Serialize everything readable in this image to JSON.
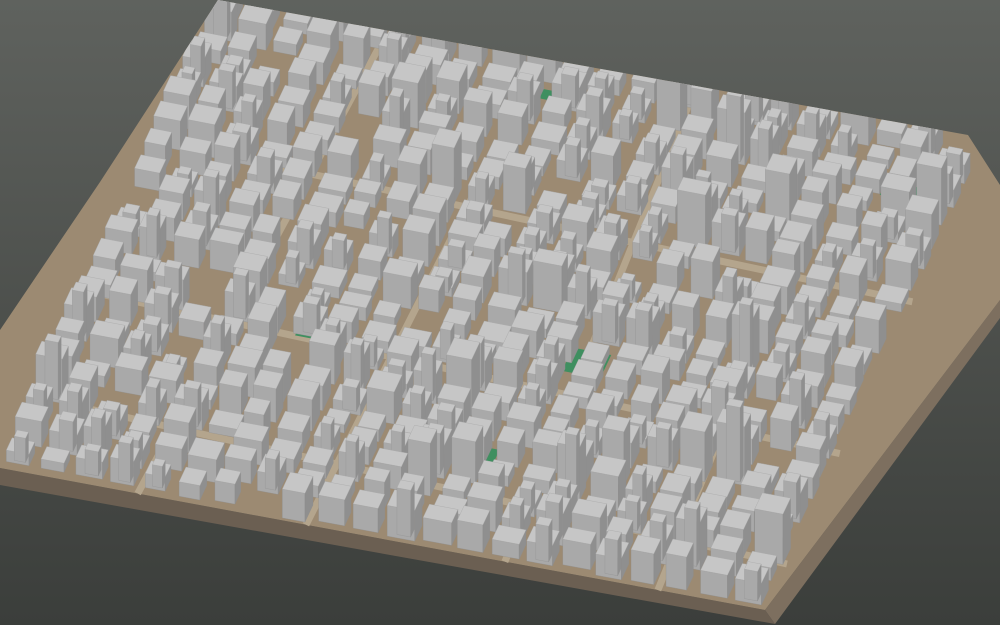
{
  "scene": {
    "subject": "3d-city-block-model",
    "colors": {
      "background_top": "#5f625e",
      "background_bottom": "#3b3e3b",
      "base_side": "#7d6f5f",
      "base_front": "#6b5f52",
      "ground": "#9c8a72",
      "road": "#b4a58d",
      "green": "#3f8f60",
      "building_top": "#c6c6c6",
      "building_left": "#a9a9a9",
      "building_right": "#8f8f8f"
    }
  }
}
